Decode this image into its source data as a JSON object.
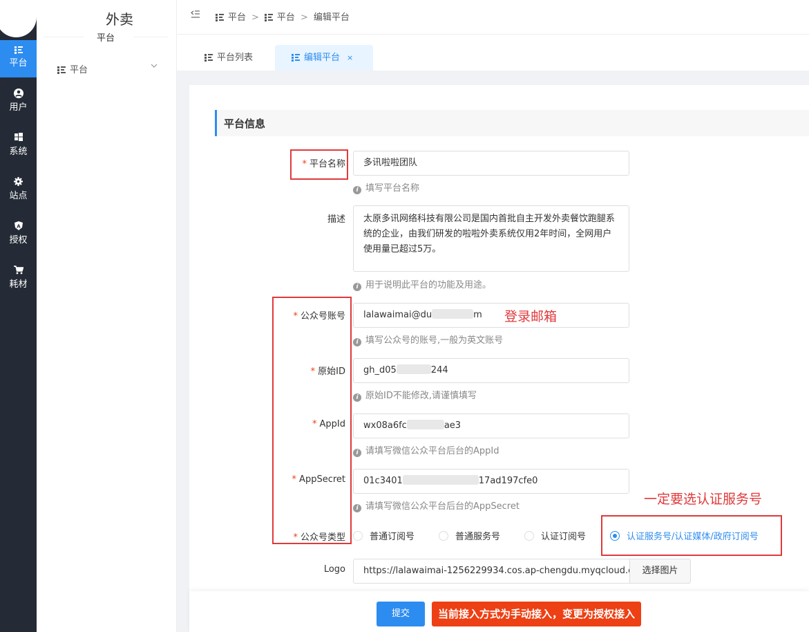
{
  "nav": {
    "items": [
      {
        "label": "平台",
        "icon": "list-icon"
      },
      {
        "label": "用户",
        "icon": "user-icon"
      },
      {
        "label": "系统",
        "icon": "windows-icon"
      },
      {
        "label": "站点",
        "icon": "gear-icon"
      },
      {
        "label": "授权",
        "icon": "shield-icon"
      },
      {
        "label": "耗材",
        "icon": "cart-icon"
      }
    ]
  },
  "sidebar": {
    "title": "外卖",
    "subtitle": "平台",
    "menu_label": "平台"
  },
  "breadcrumb": {
    "items": [
      "平台",
      "平台",
      "编辑平台"
    ]
  },
  "tabs": [
    {
      "label": "平台列表"
    },
    {
      "label": "编辑平台",
      "close": "×"
    }
  ],
  "section": {
    "title": "平台信息"
  },
  "form": {
    "name": {
      "label": "平台名称",
      "value": "多讯啦啦团队",
      "help": "填写平台名称"
    },
    "desc": {
      "label": "描述",
      "value": "太原多讯网络科技有限公司是国内首批自主开发外卖餐饮跑腿系统的企业，由我们研发的啦啦外卖系统仅用2年时间，全网用户使用量已超过5万。",
      "help": "用于说明此平台的功能及用途。"
    },
    "account": {
      "label": "公众号账号",
      "value_a": "lalawaimai@du",
      "value_b": "m",
      "help": "填写公众号的账号,一般为英文账号"
    },
    "original_id": {
      "label": "原始ID",
      "value_a": "gh_d05",
      "value_b": "244",
      "help": "原始ID不能修改,请谨慎填写"
    },
    "appid": {
      "label": "AppId",
      "value_a": "wx08a6fc",
      "value_b": "ae3",
      "help": "请填写微信公众平台后台的AppId"
    },
    "appsecret": {
      "label": "AppSecret",
      "value_a": "01c3401",
      "value_b": "17ad197cfe0",
      "help": "请填写微信公众平台后台的AppSecret"
    },
    "type": {
      "label": "公众号类型",
      "options": [
        "普通订阅号",
        "普通服务号",
        "认证订阅号",
        "认证服务号/认证媒体/政府订阅号"
      ],
      "selected_index": 3
    },
    "logo": {
      "label": "Logo",
      "value": "https://lalawaimai-1256229934.cos.ap-chengdu.myqcloud.c",
      "button": "选择图片"
    }
  },
  "footer": {
    "submit": "提交",
    "switch": "当前接入方式为手动接入，变更为授权接入"
  },
  "annotations": {
    "login_email": "登录邮箱",
    "must_select": "一定要选认证服务号"
  },
  "colors": {
    "accent": "#2d8cf0",
    "danger": "#ed4014",
    "annotation": "#e0393b",
    "nav_bg": "#242b36"
  }
}
